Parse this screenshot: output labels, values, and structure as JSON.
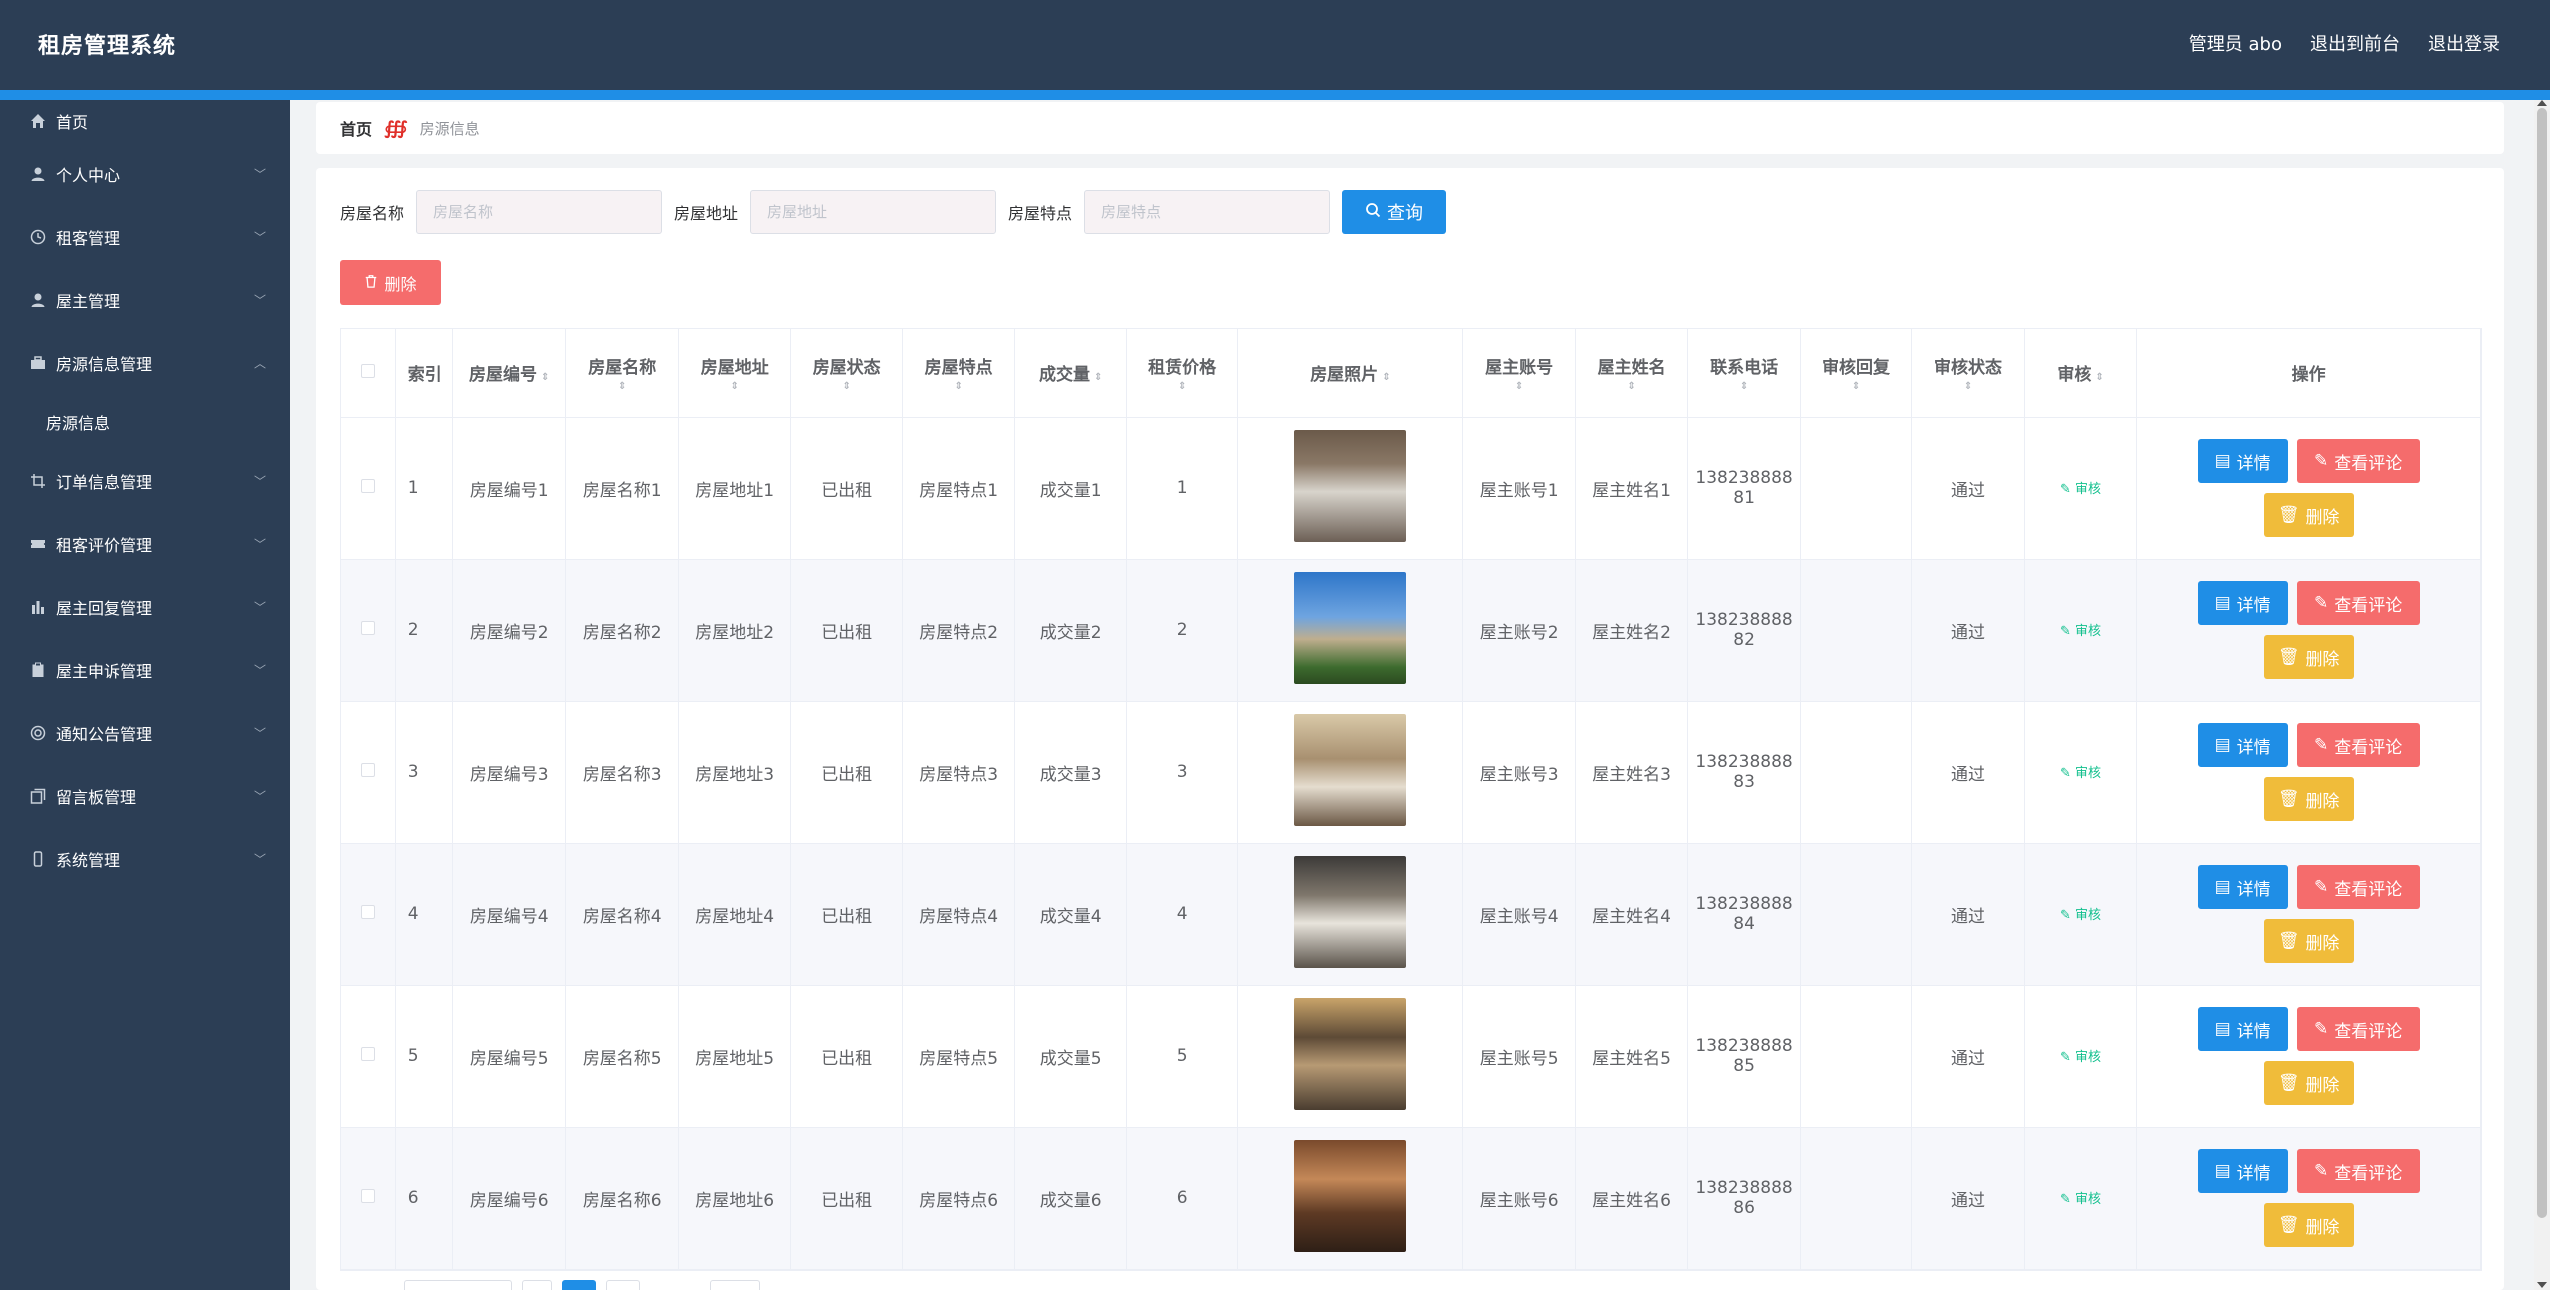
{
  "header": {
    "title": "租房管理系统",
    "admin": "管理员 abo",
    "back_front": "退出到前台",
    "logout": "退出登录"
  },
  "sidebar": {
    "items": [
      {
        "label": "首页",
        "icon": "home-icon"
      },
      {
        "label": "个人中心",
        "icon": "user-icon"
      },
      {
        "label": "租客管理",
        "icon": "clock-icon"
      },
      {
        "label": "屋主管理",
        "icon": "user-icon"
      },
      {
        "label": "房源信息管理",
        "icon": "briefcase-icon"
      },
      {
        "label": "订单信息管理",
        "icon": "crop-icon"
      },
      {
        "label": "租客评价管理",
        "icon": "ticket-icon"
      },
      {
        "label": "屋主回复管理",
        "icon": "chart-icon"
      },
      {
        "label": "屋主申诉管理",
        "icon": "clipboard-icon"
      },
      {
        "label": "通知公告管理",
        "icon": "globe-icon"
      },
      {
        "label": "留言板管理",
        "icon": "copy-icon"
      },
      {
        "label": "系统管理",
        "icon": "mobile-icon"
      }
    ],
    "sub_item": "房源信息"
  },
  "breadcrumb": {
    "home": "首页",
    "current": "房源信息"
  },
  "search": {
    "name_label": "房屋名称",
    "name_placeholder": "房屋名称",
    "addr_label": "房屋地址",
    "addr_placeholder": "房屋地址",
    "feat_label": "房屋特点",
    "feat_placeholder": "房屋特点",
    "query_label": "查询"
  },
  "delete_label": "删除",
  "table": {
    "headers": {
      "index": "索引",
      "code": "房屋编号",
      "name": "房屋名称",
      "addr": "房屋地址",
      "status": "房屋状态",
      "feat": "房屋特点",
      "deals": "成交量",
      "price": "租赁价格",
      "photo": "房屋照片",
      "owner_acct": "屋主账号",
      "owner_name": "屋主姓名",
      "phone": "联系电话",
      "audit_reply": "审核回复",
      "audit_status": "审核状态",
      "audit": "审核",
      "ops": "操作"
    },
    "rows": [
      {
        "index": "1",
        "code": "房屋编号1",
        "name": "房屋名称1",
        "addr": "房屋地址1",
        "status": "已出租",
        "feat": "房屋特点1",
        "deals": "成交量1",
        "price": "1",
        "owner_acct": "屋主账号1",
        "owner_name": "屋主姓名1",
        "phone1": "138238888",
        "phone2": "81",
        "audit_reply": "",
        "audit_status": "通过",
        "audit": "审核"
      },
      {
        "index": "2",
        "code": "房屋编号2",
        "name": "房屋名称2",
        "addr": "房屋地址2",
        "status": "已出租",
        "feat": "房屋特点2",
        "deals": "成交量2",
        "price": "2",
        "owner_acct": "屋主账号2",
        "owner_name": "屋主姓名2",
        "phone1": "138238888",
        "phone2": "82",
        "audit_reply": "",
        "audit_status": "通过",
        "audit": "审核"
      },
      {
        "index": "3",
        "code": "房屋编号3",
        "name": "房屋名称3",
        "addr": "房屋地址3",
        "status": "已出租",
        "feat": "房屋特点3",
        "deals": "成交量3",
        "price": "3",
        "owner_acct": "屋主账号3",
        "owner_name": "屋主姓名3",
        "phone1": "138238888",
        "phone2": "83",
        "audit_reply": "",
        "audit_status": "通过",
        "audit": "审核"
      },
      {
        "index": "4",
        "code": "房屋编号4",
        "name": "房屋名称4",
        "addr": "房屋地址4",
        "status": "已出租",
        "feat": "房屋特点4",
        "deals": "成交量4",
        "price": "4",
        "owner_acct": "屋主账号4",
        "owner_name": "屋主姓名4",
        "phone1": "138238888",
        "phone2": "84",
        "audit_reply": "",
        "audit_status": "通过",
        "audit": "审核"
      },
      {
        "index": "5",
        "code": "房屋编号5",
        "name": "房屋名称5",
        "addr": "房屋地址5",
        "status": "已出租",
        "feat": "房屋特点5",
        "deals": "成交量5",
        "price": "5",
        "owner_acct": "屋主账号5",
        "owner_name": "屋主姓名5",
        "phone1": "138238888",
        "phone2": "85",
        "audit_reply": "",
        "audit_status": "通过",
        "audit": "审核"
      },
      {
        "index": "6",
        "code": "房屋编号6",
        "name": "房屋名称6",
        "addr": "房屋地址6",
        "status": "已出租",
        "feat": "房屋特点6",
        "deals": "成交量6",
        "price": "6",
        "owner_acct": "屋主账号6",
        "owner_name": "屋主姓名6",
        "phone1": "138238888",
        "phone2": "86",
        "audit_reply": "",
        "audit_status": "通过",
        "audit": "审核"
      }
    ],
    "ops": {
      "detail": "详情",
      "review": "查看评论",
      "delete": "删除"
    }
  },
  "colors": {
    "header_bg": "#2c3e55",
    "accent_blue": "#1f8ee6",
    "danger": "#f56c6c",
    "warning": "#f0bc3a",
    "success": "#13c08e"
  }
}
